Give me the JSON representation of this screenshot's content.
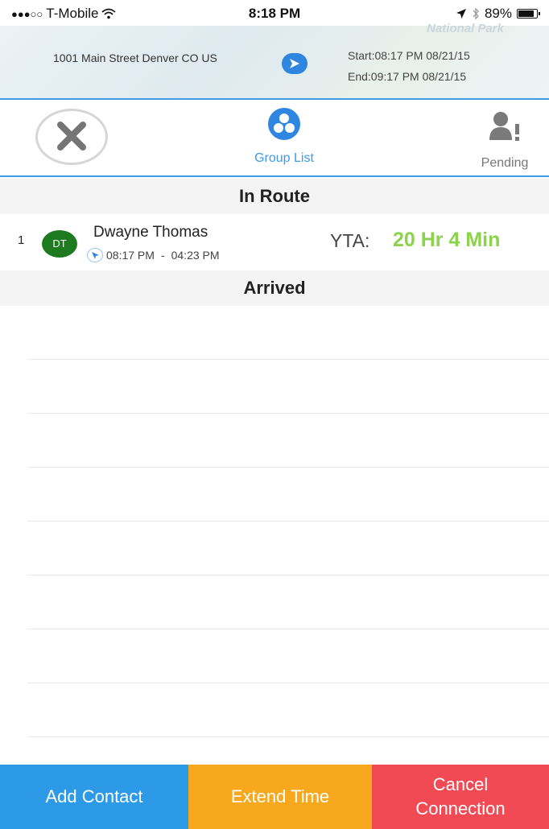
{
  "status_bar": {
    "carrier": "T-Mobile",
    "time": "8:18 PM",
    "battery_percent": "89%",
    "battery_level": 0.89,
    "icons": [
      "signal-dots-icon",
      "wifi-icon",
      "location-arrow-icon",
      "bluetooth-icon",
      "battery-icon"
    ]
  },
  "map_header": {
    "watermark": "National Park",
    "address": "1001 Main Street Denver CO US",
    "start": "Start:08:17 PM 08/21/15",
    "end": "End:09:17 PM 08/21/15",
    "accent_color": "#2e86e0"
  },
  "tabs": {
    "group_label": "Group List",
    "pending_label": "Pending",
    "active_color": "#3d9be9"
  },
  "sections": {
    "in_route": "In Route",
    "arrived": "Arrived"
  },
  "contacts": [
    {
      "index": "1",
      "initials": "DT",
      "name": "Dwayne Thomas",
      "start_time": "08:17 PM",
      "separator": "-",
      "end_time": "04:23 PM",
      "yta_label": "YTA:",
      "yta_value": "20 Hr 4 Min",
      "avatar_color": "#1e7a1e",
      "yta_color": "#8bd34a"
    }
  ],
  "buttons": {
    "add_contact": "Add Contact",
    "extend_time": "Extend Time",
    "cancel_line1": "Cancel",
    "cancel_line2": "Connection",
    "colors": {
      "add": "#2d9ae8",
      "extend": "#f7a81c",
      "cancel": "#f24a55"
    }
  }
}
